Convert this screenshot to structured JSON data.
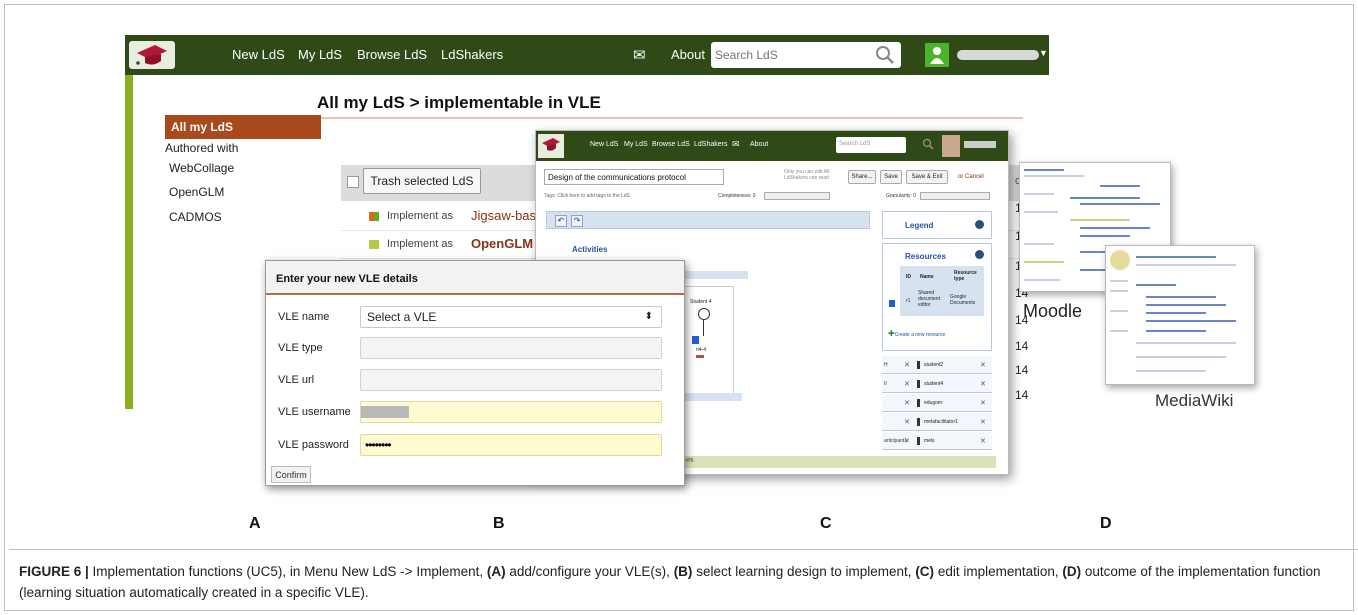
{
  "lds_app": {
    "nav": {
      "items": [
        "New LdS",
        "My LdS",
        "Browse LdS",
        "LdShakers",
        "About"
      ],
      "search_placeholder": "Search LdS"
    },
    "page_title": "All my LdS > implementable in VLE",
    "sidebar": {
      "header": "All my LdS",
      "subheader": "Authored with",
      "items": [
        "WebCollage",
        "OpenGLM",
        "CADMOS"
      ]
    },
    "trash_button": "Trash selected LdS",
    "column_header_fragment": "ow",
    "rows": [
      {
        "action": "Implement as",
        "name": "Jigsaw-base"
      },
      {
        "action": "Implement as",
        "name": "OpenGLM ("
      }
    ],
    "right_values": [
      "14",
      "14",
      "14",
      "14",
      "14",
      "14",
      "14",
      "14"
    ]
  },
  "vle_dialog": {
    "title": "Enter your new VLE details",
    "fields": [
      {
        "label": "VLE name",
        "value": "Select a VLE"
      },
      {
        "label": "VLE type",
        "value": ""
      },
      {
        "label": "VLE url",
        "value": ""
      },
      {
        "label": "VLE username",
        "value": ""
      },
      {
        "label": "VLE password",
        "value": "••••••••"
      }
    ],
    "confirm": "Confirm"
  },
  "editor": {
    "nav": [
      "New LdS",
      "My LdS",
      "Browse LdS",
      "LdShakers",
      "About"
    ],
    "search_placeholder": "Search LdS",
    "title_value": "Design of the communications protocol",
    "note": "Only you can edit All LdShakers can read",
    "buttons": [
      "Share...",
      "Save",
      "Save & Exit"
    ],
    "cancel": "or Cancel",
    "tags_hint": "Tags: Click here to add tags to the LdS",
    "completeness": "Completeness: 0",
    "granularity": "Granularity: 0",
    "activities": "Activities",
    "student_label": "Student 4",
    "node_label": "n4-4",
    "legend": "Legend",
    "resources": "Resources",
    "resource_table": {
      "headers": [
        "ID",
        "Name",
        "Resource type"
      ],
      "row": {
        "id": "r1",
        "name": "Shared document editor",
        "type": "Google Documents"
      }
    },
    "create_resource": "Create a new resource",
    "participants": [
      {
        "id": "H",
        "name": "student2"
      },
      {
        "id": "II",
        "name": "student4"
      },
      {
        "id": "",
        "name": "edugom"
      },
      {
        "id": "",
        "name": "metafacilitator1"
      },
      {
        "id": "articipant1",
        "name": "mels"
      }
    ],
    "bottom_label": "D-P5"
  },
  "outcome": {
    "moodle_label": "Moodle",
    "mediawiki_label": "MediaWiki"
  },
  "panel_letters": [
    "A",
    "B",
    "C",
    "D"
  ],
  "caption": {
    "figure": "FIGURE 6 |",
    "part1": " Implementation functions (UC5), in Menu New LdS -> Implement, ",
    "a": "(A)",
    "part2": " add/configure your VLE(s), ",
    "b": "(B)",
    "part3": " select learning design to implement, ",
    "c": "(C)",
    "part4": " edit implementation, ",
    "d": "(D)",
    "part5": " outcome of the implementation function (learning situation automatically created in a specific VLE)."
  },
  "colors": {
    "nav_bg": "#2f4a16",
    "accent_brown": "#a84a1c",
    "sidebar_green": "#8bb01e",
    "link_blue": "#2451a5"
  }
}
